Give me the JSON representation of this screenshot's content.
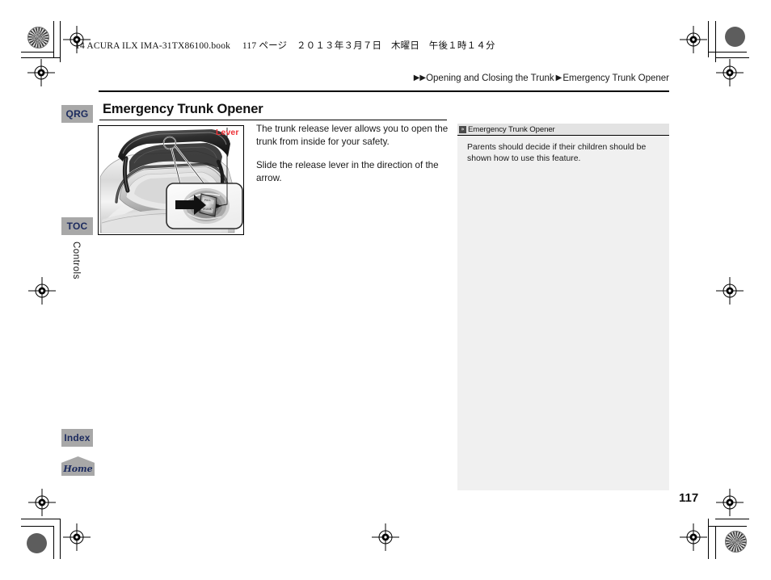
{
  "book_header": "14 ACURA ILX IMA-31TX86100.book 　117 ページ　２０１３年３月７日　木曜日　午後１時１４分",
  "breadcrumb": {
    "double_arrow": "▶▶",
    "section": "Opening and Closing the Trunk",
    "single_arrow": "▶",
    "page": "Emergency Trunk Opener"
  },
  "tabs": {
    "qrg": "QRG",
    "toc": "TOC",
    "index": "Index",
    "home": "Home"
  },
  "chapter_label": "Controls",
  "title": "Emergency Trunk Opener",
  "figure": {
    "caption_label": "Lever",
    "alt": "Open trunk of vehicle with magnified inset showing glow-in-the-dark emergency release lever and a black arrow indicating slide direction"
  },
  "body": {
    "paragraph_1": "The trunk release lever allows you to open the trunk from inside for your safety.",
    "paragraph_2": "Slide the release lever in the direction of the arrow."
  },
  "note": {
    "icon": "double-chevron-icon",
    "heading": "Emergency Trunk Opener",
    "text": "Parents should decide if their children should be shown how to use this feature."
  },
  "page_number": "117",
  "colors": {
    "tab_background": "#a8a8a8",
    "tab_text": "#1b2a5e",
    "lever_label": "#ed3237",
    "note_background": "#f0f0f0",
    "note_header_background": "#e3e3e3"
  }
}
